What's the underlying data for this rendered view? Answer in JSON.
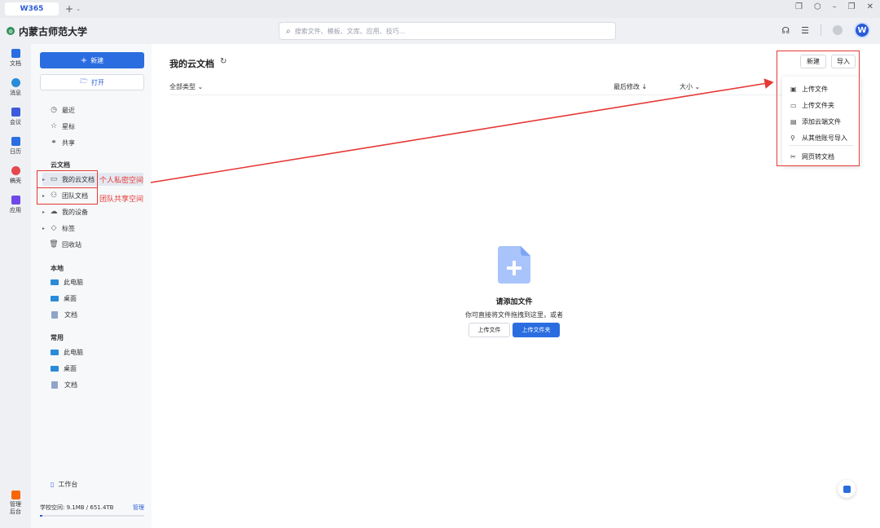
{
  "app": {
    "tab_label": "W365",
    "add_tab": "+",
    "more": "⌄"
  },
  "window": {
    "icons": [
      "restore-icon",
      "cube-icon",
      "minimize-icon",
      "maximize-icon",
      "close-icon"
    ]
  },
  "org": {
    "logo": "◍",
    "name": "内蒙古师范大学"
  },
  "search": {
    "placeholder": "搜索文件、模板、文库、应用、技巧..."
  },
  "rail": [
    {
      "label": "文档",
      "color": "#2a6de0"
    },
    {
      "label": "消息",
      "color": "#2a8bd8"
    },
    {
      "label": "会议",
      "color": "#3b5bdb"
    },
    {
      "label": "日历",
      "color": "#2a6de0"
    },
    {
      "label": "稿壳",
      "color": "#e5484d"
    },
    {
      "label": "应用",
      "color": "#7048e8"
    },
    {
      "label": "管理后台",
      "color": "#f76707"
    }
  ],
  "sidebar": {
    "new_label": "新建",
    "open_label": "打开",
    "recent": "最近",
    "starred": "星标",
    "shared": "共享",
    "cloud_section": "云文档",
    "my_cloud": "我的云文档",
    "team_docs": "团队文档",
    "my_devices": "我的设备",
    "tags": "标签",
    "recycle": "回收站",
    "local_section": "本地",
    "local_items": [
      "此电脑",
      "桌面",
      "文档"
    ],
    "common_section": "常用",
    "common_items": [
      "此电脑",
      "桌面",
      "文档"
    ],
    "workbench": "工作台",
    "storage_text": "学校空间: 9.1MB / 651.4TB",
    "manage": "管理",
    "storage_used_fraction": 0.02
  },
  "annotations": {
    "private": "个人私密空间",
    "team": "团队共享空间",
    "color": "#e53935"
  },
  "main": {
    "title": "我的云文档",
    "filter": "全部类型 ⌄",
    "col_modified": "最后修改 ↓",
    "col_size": "大小 ⌄",
    "new_btn": "新建",
    "import_btn": "导入",
    "menu": [
      "上传文件",
      "上传文件夹",
      "添加云端文件",
      "从其他账号导入",
      "网页转文档"
    ],
    "empty_title": "请添加文件",
    "empty_sub": "你可直接将文件拖拽到这里，或者",
    "upload_file": "上传文件",
    "upload_folder": "上传文件夹"
  },
  "colors": {
    "accent": "#2a6de0",
    "annotation": "#e53935"
  }
}
